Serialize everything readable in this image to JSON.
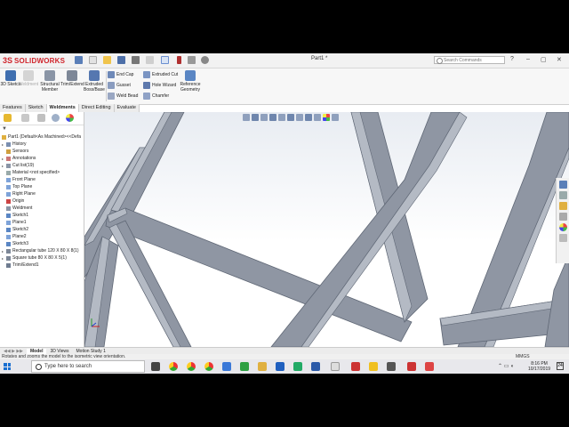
{
  "app": {
    "brand_ds": "3S",
    "brand_name": "SOLIDWORKS",
    "document_title": "Part1 *",
    "search_placeholder": "Search Commands",
    "window_controls": [
      "?",
      "–",
      "▢",
      "✕"
    ]
  },
  "command_manager": {
    "large_buttons": [
      {
        "label": "3D Sketch",
        "icon": "3d-sketch-icon",
        "enabled": true
      },
      {
        "label": "Weldment",
        "icon": "weldment-icon",
        "enabled": false
      },
      {
        "label": "Structural Member",
        "icon": "structural-member-icon",
        "enabled": true
      },
      {
        "label": "Trim/Extend",
        "icon": "trim-extend-icon",
        "enabled": true
      },
      {
        "label": "Extruded Boss/Base",
        "icon": "extruded-boss-icon",
        "enabled": true
      }
    ],
    "small_buttons": [
      {
        "label": "End Cap",
        "icon": "end-cap-icon"
      },
      {
        "label": "Gusset",
        "icon": "gusset-icon"
      },
      {
        "label": "Weld Bead",
        "icon": "weld-bead-icon"
      },
      {
        "label": "Extruded Cut",
        "icon": "extruded-cut-icon"
      },
      {
        "label": "Hole Wizard",
        "icon": "hole-wizard-icon"
      },
      {
        "label": "Chamfer",
        "icon": "chamfer-icon"
      }
    ],
    "reference_geometry": "Reference Geometry"
  },
  "tabs": [
    "Features",
    "Sketch",
    "Weldments",
    "Direct Editing",
    "Evaluate"
  ],
  "active_tab": "Weldments",
  "feature_tree": {
    "root": "Part1  (Default<As Machined><<Defa",
    "items": [
      {
        "label": "History",
        "icon": "history-icon",
        "expand": true
      },
      {
        "label": "Sensors",
        "icon": "sensors-icon",
        "expand": false
      },
      {
        "label": "Annotations",
        "icon": "annotations-icon",
        "expand": true
      },
      {
        "label": "Cut list(19)",
        "icon": "cut-list-icon",
        "expand": true
      },
      {
        "label": "Material <not specified>",
        "icon": "material-icon",
        "expand": false
      },
      {
        "label": "Front Plane",
        "icon": "plane-icon",
        "expand": false
      },
      {
        "label": "Top Plane",
        "icon": "plane-icon",
        "expand": false
      },
      {
        "label": "Right Plane",
        "icon": "plane-icon",
        "expand": false
      },
      {
        "label": "Origin",
        "icon": "origin-icon",
        "expand": false
      },
      {
        "label": "Weldment",
        "icon": "weldment-icon",
        "expand": false
      },
      {
        "label": "Sketch1",
        "icon": "sketch-icon",
        "expand": false
      },
      {
        "label": "Plane1",
        "icon": "plane-icon",
        "expand": false
      },
      {
        "label": "Sketch2",
        "icon": "sketch-icon",
        "expand": false
      },
      {
        "label": "Plane2",
        "icon": "plane-icon",
        "expand": false
      },
      {
        "label": "Sketch3",
        "icon": "sketch-icon",
        "expand": false
      },
      {
        "label": "Rectangular tube 120 X 80 X 8(1)",
        "icon": "structural-member-icon",
        "expand": true
      },
      {
        "label": "Square tube 80 X 80 X 5(1)",
        "icon": "structural-member-icon",
        "expand": true
      },
      {
        "label": "Trim/Extend1",
        "icon": "trim-extend-icon",
        "expand": false
      }
    ]
  },
  "bottom_tabs": [
    "Model",
    "3D Views",
    "Motion Study 1"
  ],
  "active_bottom_tab": "Model",
  "status": {
    "message": "Rotates and zooms the model to the isometric view orientation.",
    "units": "MMGS"
  },
  "taskbar": {
    "search_placeholder": "Type here to search",
    "time": "8:16 PM",
    "date": "10/17/2019",
    "notification_count": "24"
  },
  "colors": {
    "brand_red": "#d0242b",
    "tube_face": "#8f96a3",
    "tube_dark": "#5f6775",
    "tube_light": "#b4bac4"
  }
}
